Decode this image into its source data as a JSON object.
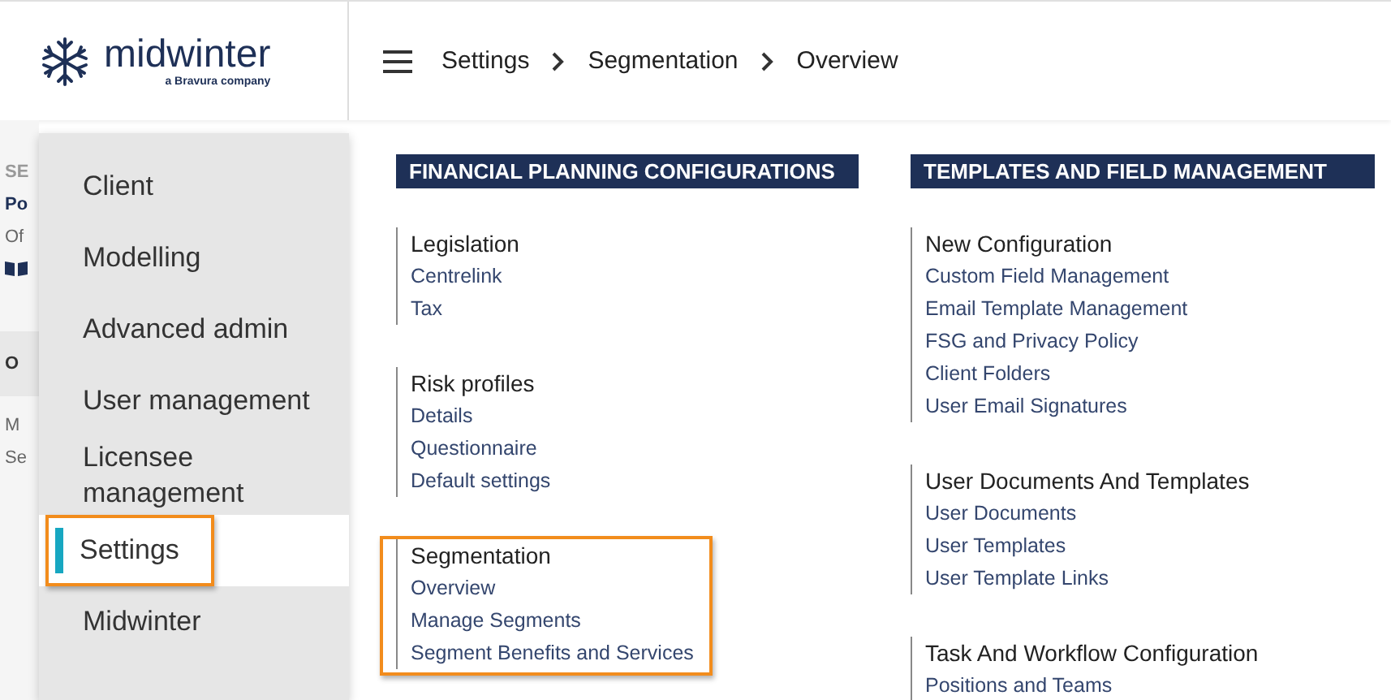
{
  "header": {
    "logo": {
      "name": "midwinter",
      "tagline": "a Bravura company"
    },
    "breadcrumbs": [
      "Settings",
      "Segmentation",
      "Overview"
    ]
  },
  "background_panel": {
    "texts": [
      {
        "text": "SE",
        "kind": "label"
      },
      {
        "text": "Po",
        "kind": "title"
      },
      {
        "text": "Of",
        "kind": "body"
      },
      {
        "kind": "book"
      },
      {
        "text": "O",
        "kind": "band"
      },
      {
        "text": "M",
        "kind": "body"
      },
      {
        "text": "Se",
        "kind": "body"
      }
    ]
  },
  "menu": [
    {
      "label": "Client",
      "selected": false,
      "highlighted": false
    },
    {
      "label": "Modelling",
      "selected": false,
      "highlighted": false
    },
    {
      "label": "Advanced admin",
      "selected": false,
      "highlighted": false
    },
    {
      "label": "User management",
      "selected": false,
      "highlighted": false
    },
    {
      "label": "Licensee management",
      "selected": false,
      "highlighted": false
    },
    {
      "label": "Settings",
      "selected": true,
      "highlighted": true
    },
    {
      "label": "Midwinter",
      "selected": false,
      "highlighted": false
    }
  ],
  "sections": [
    {
      "heading": "FINANCIAL PLANNING CONFIGURATIONS",
      "groups": [
        {
          "title": "Legislation",
          "highlighted": false,
          "links": [
            "Centrelink",
            "Tax"
          ]
        },
        {
          "title": "Risk profiles",
          "highlighted": false,
          "links": [
            "Details",
            "Questionnaire",
            "Default settings"
          ]
        },
        {
          "title": "Segmentation",
          "highlighted": true,
          "links": [
            "Overview",
            "Manage Segments",
            "Segment Benefits and Services"
          ]
        }
      ]
    },
    {
      "heading": "TEMPLATES AND FIELD MANAGEMENT",
      "groups": [
        {
          "title": "New Configuration",
          "highlighted": false,
          "links": [
            "Custom Field Management",
            "Email Template Management",
            "FSG and Privacy Policy",
            "Client Folders",
            "User Email Signatures"
          ]
        },
        {
          "title": "User Documents And Templates",
          "highlighted": false,
          "links": [
            "User Documents",
            "User Templates",
            "User Template Links"
          ]
        },
        {
          "title": "Task And Workflow Configuration",
          "highlighted": false,
          "links": [
            "Positions and Teams"
          ]
        }
      ]
    }
  ]
}
